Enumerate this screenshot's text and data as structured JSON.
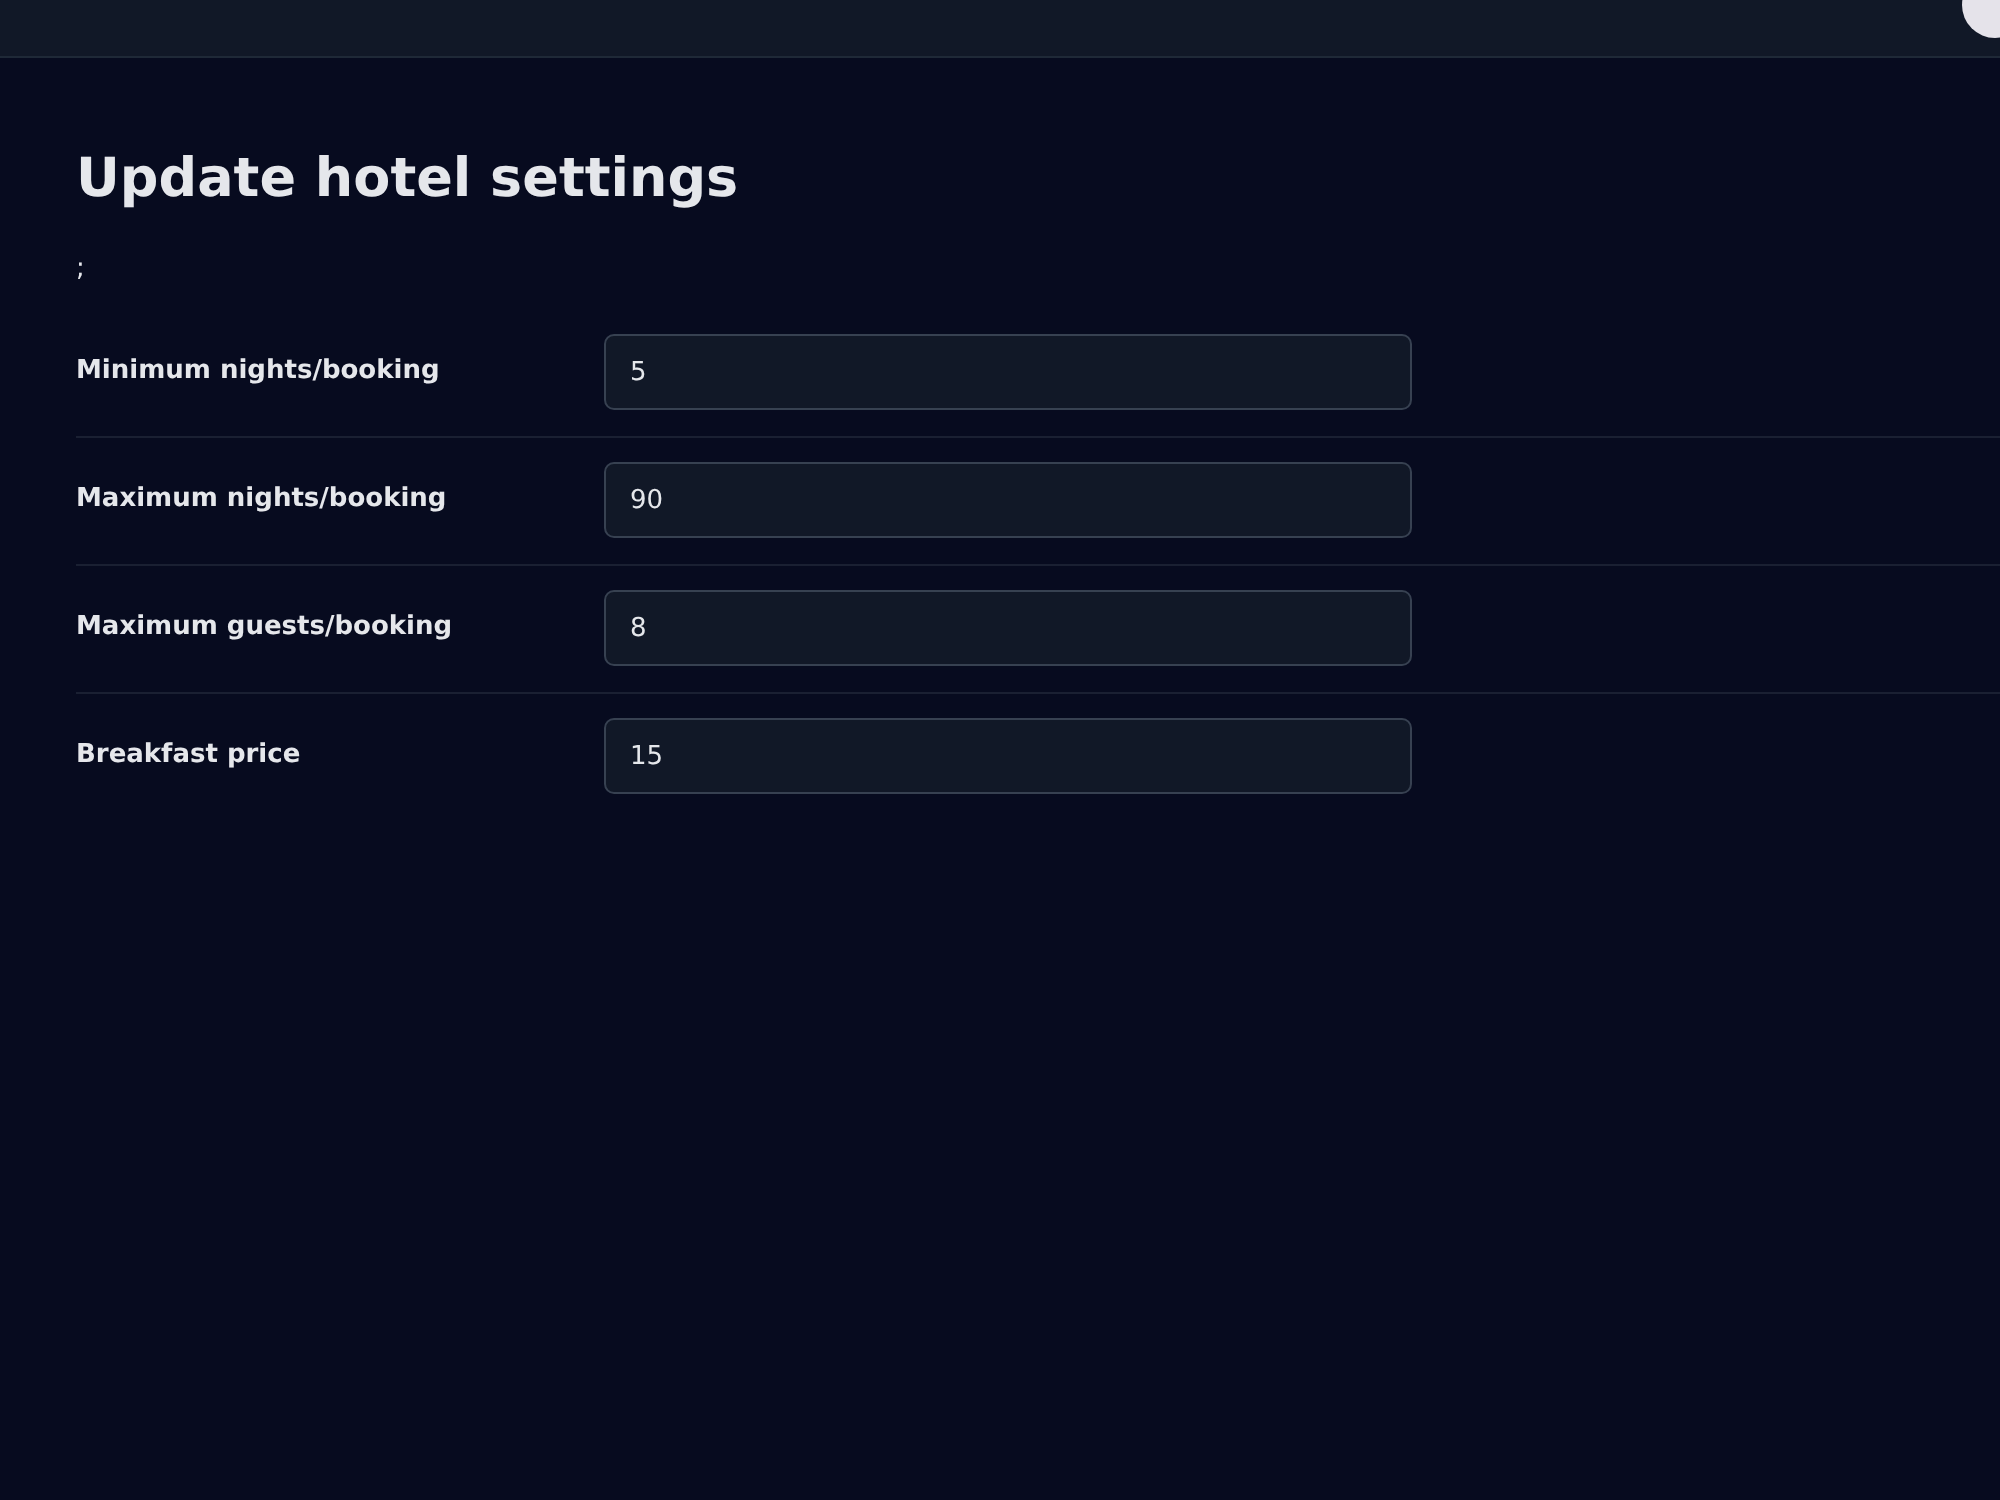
{
  "title": "Update hotel settings",
  "note": ";",
  "fields": [
    {
      "label": "Minimum nights/booking",
      "value": "5"
    },
    {
      "label": "Maximum nights/booking",
      "value": "90"
    },
    {
      "label": "Maximum guests/booking",
      "value": "8"
    },
    {
      "label": "Breakfast price",
      "value": "15"
    }
  ]
}
